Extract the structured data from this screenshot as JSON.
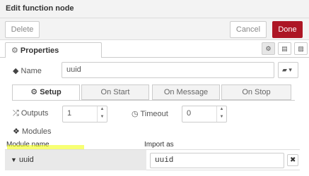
{
  "title": "Edit function node",
  "toolbar": {
    "delete_label": "Delete",
    "cancel_label": "Cancel",
    "done_label": "Done"
  },
  "properties_tab": {
    "icon": "gear-icon",
    "label": "Properties"
  },
  "name_field": {
    "label": "Name",
    "value": "uuid"
  },
  "setup_tabs": [
    {
      "label": "Setup",
      "active": true
    },
    {
      "label": "On Start"
    },
    {
      "label": "On Message"
    },
    {
      "label": "On Stop"
    }
  ],
  "outputs": {
    "label": "Outputs",
    "value": "1"
  },
  "timeout": {
    "label": "Timeout",
    "value": "0"
  },
  "modules": {
    "label": "Modules",
    "col_module_name": "Module name",
    "col_import_as": "Import as",
    "rows": [
      {
        "module": "uuid",
        "import_as": "uuid"
      }
    ]
  },
  "colors": {
    "done": "#ad1625",
    "highlight": "#f0ff00"
  }
}
